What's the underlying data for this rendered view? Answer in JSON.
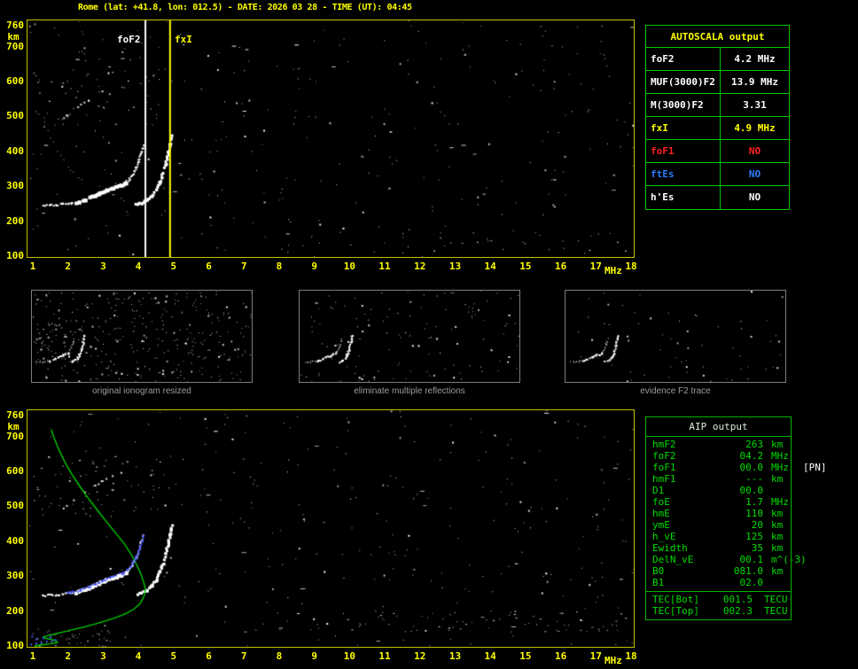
{
  "header": {
    "title": "Rome (lat: +41.8, lon: 012.5) - DATE: 2026 03 28 - TIME (UT): 04:45"
  },
  "plots": {
    "top": {
      "foF2_label": "foF2",
      "fxI_label": "fxI",
      "y_unit": "km",
      "x_unit": "MHz"
    },
    "bottom": {
      "y_unit": "km",
      "x_unit": "MHz"
    }
  },
  "autoscala": {
    "title": "AUTOSCALA output",
    "rows": [
      {
        "label": "foF2",
        "value": "4.2 MHz",
        "color": "#ffffff"
      },
      {
        "label": "MUF(3000)F2",
        "value": "13.9 MHz",
        "color": "#ffffff"
      },
      {
        "label": "M(3000)F2",
        "value": "3.31",
        "color": "#ffffff"
      },
      {
        "label": "fxI",
        "value": "4.9 MHz",
        "color": "#ffff00"
      },
      {
        "label": "foF1",
        "value": "NO",
        "color": "#ff2222"
      },
      {
        "label": "ftEs",
        "value": "NO",
        "color": "#2e7bff"
      },
      {
        "label": "h'Es",
        "value": "NO",
        "color": "#ffffff"
      }
    ]
  },
  "thumbnails": [
    {
      "caption": "original ionogram resized"
    },
    {
      "caption": "eliminate multiple reflections"
    },
    {
      "caption": "evidence F2 trace"
    }
  ],
  "aip": {
    "title": "AIP output",
    "rows": [
      {
        "label": "hmF2",
        "value": "263",
        "unit": "km",
        "note": ""
      },
      {
        "label": "foF2",
        "value": "04.2",
        "unit": "MHz",
        "note": ""
      },
      {
        "label": "foF1",
        "value": "00.0",
        "unit": "MHz",
        "note": "[PN]"
      },
      {
        "label": "hmF1",
        "value": "---",
        "unit": "km",
        "note": ""
      },
      {
        "label": "D1",
        "value": "00.0",
        "unit": "",
        "note": ""
      },
      {
        "label": "foE",
        "value": "1.7",
        "unit": "MHz",
        "note": ""
      },
      {
        "label": "hmE",
        "value": "110",
        "unit": "km",
        "note": ""
      },
      {
        "label": "ymE",
        "value": "20",
        "unit": "km",
        "note": ""
      },
      {
        "label": "h_vE",
        "value": "125",
        "unit": "km",
        "note": ""
      },
      {
        "label": "Ewidth",
        "value": "35",
        "unit": "km",
        "note": ""
      },
      {
        "label": "DelN_vE",
        "value": "00.1",
        "unit": "m^(-3)",
        "note": ""
      },
      {
        "label": "B0",
        "value": "081.0",
        "unit": "km",
        "note": ""
      },
      {
        "label": "B1",
        "value": "02.0",
        "unit": "",
        "note": ""
      }
    ],
    "tec_rows": [
      {
        "label": "TEC[Bot]",
        "value": "001.5",
        "unit": "TECU"
      },
      {
        "label": "TEC[Top]",
        "value": "002.3",
        "unit": "TECU"
      }
    ]
  },
  "colors": {
    "background": "#000000",
    "axis_text": "#ffff00",
    "plot_border": "#c2c200",
    "table_border": "#00c800",
    "aip_text": "#00dd00",
    "trace": "#ffffff",
    "profile_green": "#00cc00",
    "restored_blue": "#4455ff",
    "thumb_border": "#7d7d7d",
    "caption_gray": "#9c9c9c"
  },
  "chart_data": [
    {
      "type": "scatter",
      "title": "ionogram with AUTOSCALA characteristics",
      "xlabel": "MHz",
      "ylabel": "km",
      "xlim": [
        1,
        18
      ],
      "ylim": [
        100,
        760
      ],
      "x_ticks": [
        1,
        2,
        3,
        4,
        5,
        6,
        7,
        8,
        9,
        10,
        11,
        12,
        13,
        14,
        15,
        16,
        17,
        18
      ],
      "y_ticks": [
        760,
        700,
        600,
        500,
        400,
        300,
        200,
        100
      ],
      "markers": [
        {
          "label": "foF2",
          "x": 4.2,
          "color": "#ffffff"
        },
        {
          "label": "fxI",
          "x": 4.9,
          "color": "#ffff00"
        }
      ],
      "series": [
        {
          "name": "trace-ordinary",
          "style": "dots",
          "color": "#ffffff",
          "size": 2,
          "emphasis_range": [
            2.2,
            3.6
          ],
          "points": [
            [
              1.25,
              246
            ],
            [
              1.45,
              248
            ],
            [
              1.65,
              249
            ],
            [
              1.85,
              251
            ],
            [
              2.05,
              254
            ],
            [
              2.25,
              259
            ],
            [
              2.45,
              266
            ],
            [
              2.65,
              274
            ],
            [
              2.85,
              284
            ],
            [
              3.05,
              293
            ],
            [
              3.25,
              300
            ],
            [
              3.45,
              306
            ],
            [
              3.6,
              313
            ],
            [
              3.72,
              323
            ],
            [
              3.83,
              338
            ],
            [
              3.92,
              357
            ],
            [
              4.0,
              380
            ],
            [
              4.06,
              402
            ],
            [
              4.11,
              420
            ]
          ]
        },
        {
          "name": "trace-extraordinary",
          "style": "dots",
          "color": "#ffffff",
          "size": 3,
          "points": [
            [
              3.9,
              250
            ],
            [
              4.05,
              255
            ],
            [
              4.2,
              263
            ],
            [
              4.35,
              276
            ],
            [
              4.48,
              294
            ],
            [
              4.58,
              315
            ],
            [
              4.67,
              340
            ],
            [
              4.75,
              368
            ],
            [
              4.82,
              398
            ],
            [
              4.87,
              425
            ],
            [
              4.91,
              448
            ]
          ]
        },
        {
          "name": "multiple-reflection-trace",
          "style": "sparse",
          "color": "#e0e0e0",
          "size": 2,
          "points": [
            [
              1.75,
              490
            ],
            [
              1.95,
              505
            ],
            [
              2.15,
              520
            ],
            [
              2.35,
              535
            ],
            [
              2.55,
              549
            ],
            [
              2.75,
              562
            ],
            [
              2.95,
              574
            ],
            [
              3.15,
              585
            ],
            [
              3.35,
              594
            ],
            [
              3.5,
              600
            ]
          ]
        },
        {
          "name": "oblique-echo-trace",
          "style": "sparse",
          "color": "#b0b0b0",
          "size": 1,
          "points": [
            [
              1.3,
              498
            ],
            [
              1.42,
              462
            ],
            [
              1.55,
              430
            ],
            [
              1.7,
              402
            ],
            [
              1.85,
              378
            ],
            [
              2.0,
              357
            ],
            [
              2.15,
              340
            ],
            [
              2.3,
              327
            ],
            [
              2.45,
              318
            ]
          ]
        }
      ]
    },
    {
      "type": "scatter",
      "title": "restored trace and electron density profile",
      "xlabel": "MHz",
      "ylabel": "km",
      "xlim": [
        1,
        18
      ],
      "ylim": [
        100,
        760
      ],
      "x_ticks": [
        1,
        2,
        3,
        4,
        5,
        6,
        7,
        8,
        9,
        10,
        11,
        12,
        13,
        14,
        15,
        16,
        17,
        18
      ],
      "y_ticks": [
        760,
        700,
        600,
        500,
        400,
        300,
        200,
        100
      ],
      "markers": [],
      "series": [
        {
          "name": "trace-ordinary",
          "style": "dots",
          "color": "#ffffff",
          "size": 2,
          "emphasis_range": [
            2.2,
            3.6
          ],
          "points": [
            [
              1.25,
              246
            ],
            [
              1.45,
              248
            ],
            [
              1.65,
              249
            ],
            [
              1.85,
              251
            ],
            [
              2.05,
              254
            ],
            [
              2.25,
              259
            ],
            [
              2.45,
              266
            ],
            [
              2.65,
              274
            ],
            [
              2.85,
              284
            ],
            [
              3.05,
              293
            ],
            [
              3.25,
              300
            ],
            [
              3.45,
              306
            ],
            [
              3.6,
              313
            ],
            [
              3.72,
              323
            ],
            [
              3.83,
              338
            ],
            [
              3.92,
              357
            ],
            [
              4.0,
              380
            ],
            [
              4.06,
              402
            ],
            [
              4.11,
              420
            ]
          ]
        },
        {
          "name": "trace-extraordinary",
          "style": "dots",
          "color": "#ffffff",
          "size": 3,
          "points": [
            [
              3.9,
              250
            ],
            [
              4.05,
              255
            ],
            [
              4.2,
              263
            ],
            [
              4.35,
              276
            ],
            [
              4.48,
              294
            ],
            [
              4.58,
              315
            ],
            [
              4.67,
              340
            ],
            [
              4.75,
              368
            ],
            [
              4.82,
              398
            ],
            [
              4.87,
              425
            ],
            [
              4.91,
              448
            ]
          ]
        },
        {
          "name": "multiple-reflection-trace",
          "style": "sparse",
          "color": "#e0e0e0",
          "size": 2,
          "points": [
            [
              1.75,
              490
            ],
            [
              1.95,
              505
            ],
            [
              2.15,
              520
            ],
            [
              2.35,
              535
            ],
            [
              2.55,
              549
            ],
            [
              2.75,
              562
            ],
            [
              2.95,
              574
            ],
            [
              3.15,
              585
            ],
            [
              3.35,
              594
            ],
            [
              3.5,
              600
            ]
          ]
        },
        {
          "name": "electron-density-profile",
          "style": "line",
          "color": "#00cc00",
          "size": 1,
          "points": [
            [
              1.52,
              720
            ],
            [
              1.62,
              692
            ],
            [
              1.75,
              660
            ],
            [
              1.92,
              625
            ],
            [
              2.12,
              590
            ],
            [
              2.35,
              555
            ],
            [
              2.6,
              520
            ],
            [
              2.85,
              487
            ],
            [
              3.1,
              455
            ],
            [
              3.35,
              424
            ],
            [
              3.6,
              393
            ],
            [
              3.8,
              362
            ],
            [
              3.95,
              333
            ],
            [
              4.07,
              306
            ],
            [
              4.15,
              283
            ],
            [
              4.2,
              263
            ],
            [
              4.16,
              242
            ],
            [
              4.05,
              222
            ],
            [
              3.88,
              206
            ],
            [
              3.65,
              193
            ],
            [
              3.38,
              182
            ],
            [
              3.08,
              172
            ],
            [
              2.78,
              163
            ],
            [
              2.48,
              155
            ],
            [
              2.18,
              148
            ],
            [
              1.9,
              141
            ],
            [
              1.66,
              135
            ],
            [
              1.46,
              130
            ],
            [
              1.3,
              126
            ],
            [
              1.35,
              122
            ],
            [
              1.52,
              119
            ],
            [
              1.66,
              115
            ],
            [
              1.7,
              110
            ],
            [
              1.5,
              106
            ],
            [
              1.25,
              103
            ],
            [
              1.05,
              100
            ]
          ]
        },
        {
          "name": "restored-f2-trace",
          "style": "dots",
          "color": "#4455ff",
          "size": 2,
          "points": [
            [
              1.95,
              253
            ],
            [
              2.15,
              257
            ],
            [
              2.35,
              263
            ],
            [
              2.55,
              270
            ],
            [
              2.75,
              279
            ],
            [
              2.95,
              288
            ],
            [
              3.15,
              297
            ],
            [
              3.35,
              305
            ],
            [
              3.55,
              312
            ],
            [
              3.7,
              322
            ],
            [
              3.82,
              337
            ],
            [
              3.92,
              356
            ],
            [
              4.0,
              378
            ],
            [
              4.07,
              400
            ],
            [
              4.12,
              418
            ]
          ]
        },
        {
          "name": "restored-e-region",
          "style": "points",
          "color": "#4455ff",
          "size": 2,
          "points": [
            [
              0.95,
              104
            ],
            [
              1.1,
              107
            ],
            [
              1.25,
              109
            ],
            [
              1.4,
              112
            ],
            [
              1.55,
              114
            ],
            [
              1.65,
              117
            ],
            [
              1.1,
              119
            ],
            [
              1.3,
              122
            ],
            [
              1.5,
              125
            ],
            [
              0.98,
              127
            ]
          ]
        }
      ]
    }
  ]
}
